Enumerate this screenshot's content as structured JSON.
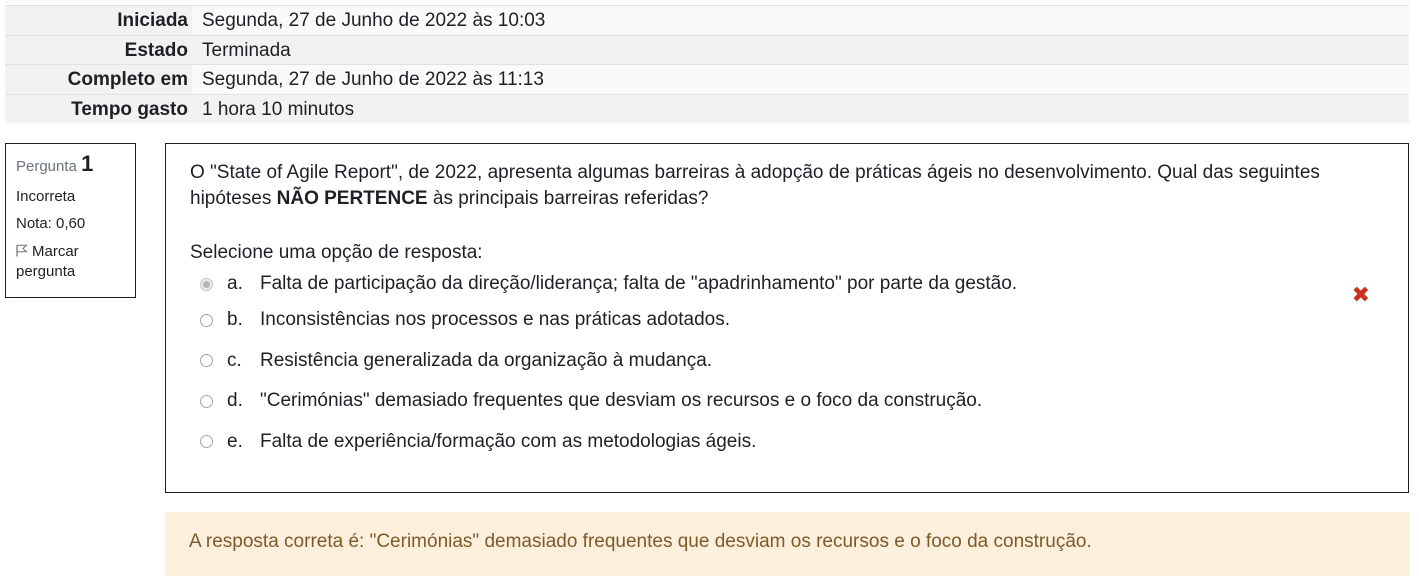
{
  "summary": {
    "rows": [
      {
        "label": "Iniciada",
        "value": "Segunda, 27 de Junho de 2022 às 10:03"
      },
      {
        "label": "Estado",
        "value": "Terminada"
      },
      {
        "label": "Completo em",
        "value": "Segunda, 27 de Junho de 2022 às 11:13"
      },
      {
        "label": "Tempo gasto",
        "value": "1 hora 10 minutos"
      }
    ]
  },
  "question_info": {
    "number_label": "Pergunta",
    "number": "1",
    "status": "Incorreta",
    "grade": "Nota: 0,60",
    "flag_label": "Marcar pergunta",
    "flag_icon": "flag-icon"
  },
  "question": {
    "text_part1": "O \"State of Agile Report\", de 2022, apresenta algumas barreiras à adopção de práticas ágeis no desenvolvimento. Qual das seguintes hipóteses ",
    "text_bold": "NÃO PERTENCE",
    "text_part2": " às principais barreiras referidas?",
    "prompt": "Selecione uma opção de resposta:",
    "options": [
      {
        "letter": "a.",
        "text": "Falta de participação da direção/liderança; falta de \"apadrinhamento\" por parte da gestão.",
        "selected": true,
        "marked_wrong": true
      },
      {
        "letter": "b.",
        "text": "Inconsistências nos processos e nas práticas adotados.",
        "selected": false
      },
      {
        "letter": "c.",
        "text": "Resistência generalizada da organização à mudança.",
        "selected": false
      },
      {
        "letter": "d.",
        "text": "\"Cerimónias\" demasiado frequentes que desviam os recursos e o foco da construção.",
        "selected": false
      },
      {
        "letter": "e.",
        "text": "Falta de experiência/formação com as metodologias ágeis.",
        "selected": false
      }
    ],
    "wrong_icon": "cross-icon"
  },
  "feedback": {
    "text": "A resposta correta é: \"Cerimónias\" demasiado frequentes que desviam os recursos e o foco da construção."
  },
  "colors": {
    "wrong": "#ca3120",
    "feedback_bg": "#fcefdc",
    "feedback_text": "#7d5a29"
  }
}
